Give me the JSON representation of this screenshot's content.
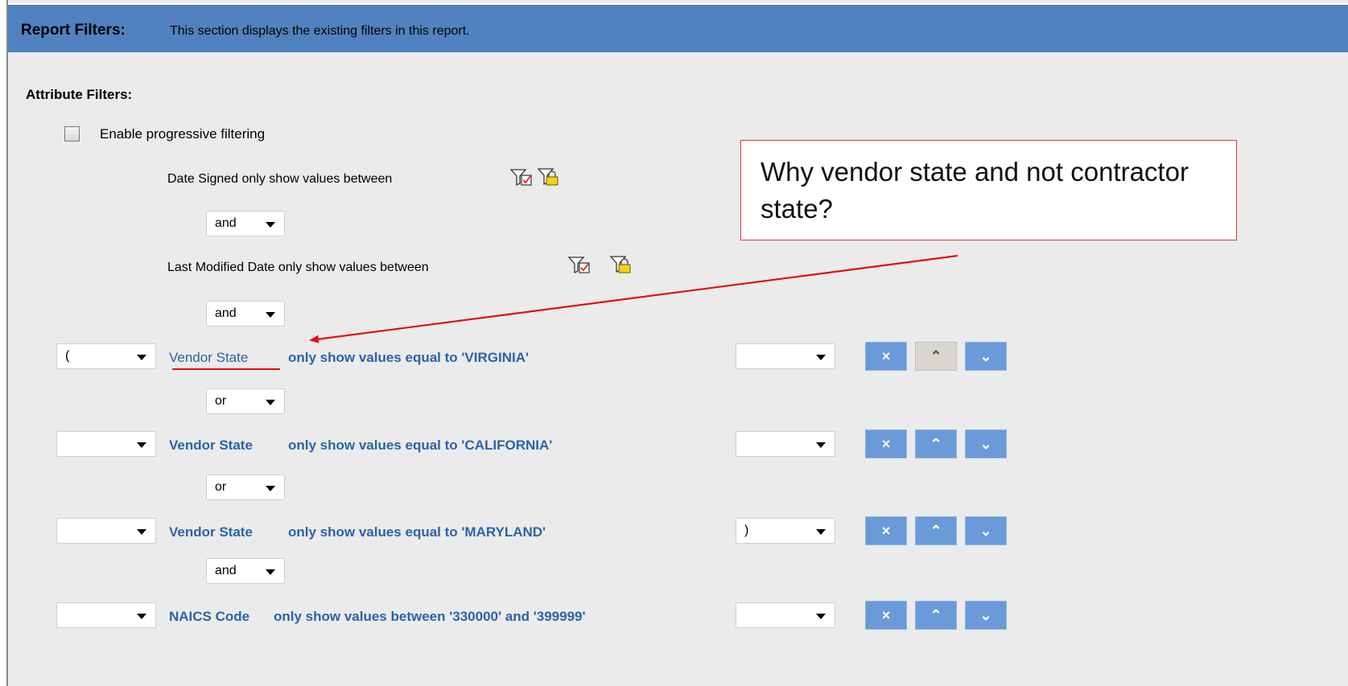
{
  "header": {
    "title": "Report Filters:",
    "description": "This section displays the existing filters in this report."
  },
  "attribute_filters_label": "Attribute Filters:",
  "progressive": {
    "label": "Enable progressive filtering",
    "checked": false
  },
  "date_filters": [
    {
      "text": "Date Signed only show values between",
      "connector": "and"
    },
    {
      "text": "Last Modified Date only show values between",
      "connector": "and"
    }
  ],
  "filters": [
    {
      "open_paren": "(",
      "attribute": "Vendor State",
      "condition": "only show values equal to 'VIRGINIA'",
      "close_paren": "",
      "connector": "or",
      "move_up_enabled": false
    },
    {
      "open_paren": "",
      "attribute": "Vendor State",
      "condition": "only show values equal to 'CALIFORNIA'",
      "close_paren": "",
      "connector": "or",
      "move_up_enabled": true
    },
    {
      "open_paren": "",
      "attribute": "Vendor State",
      "condition": "only show values equal to 'MARYLAND'",
      "close_paren": ")",
      "connector": "and",
      "move_up_enabled": true
    },
    {
      "open_paren": "",
      "attribute": "NAICS Code",
      "condition": "only show values between '330000' and '399999'",
      "close_paren": "",
      "connector": "",
      "move_up_enabled": true
    }
  ],
  "buttons": {
    "delete_glyph": "×",
    "up_glyph": "⌃",
    "down_glyph": "⌄"
  },
  "icons": [
    "filter-edit-icon",
    "filter-lock-icon",
    "chevron-down-icon",
    "remove-icon",
    "move-up-icon",
    "move-down-icon"
  ],
  "annotation": {
    "text": "Why vendor state and not contractor state?"
  },
  "colors": {
    "header": "#5082bf",
    "link": "#2b63a8",
    "button": "#6a9ad8",
    "annotation": "#d63a3a"
  }
}
